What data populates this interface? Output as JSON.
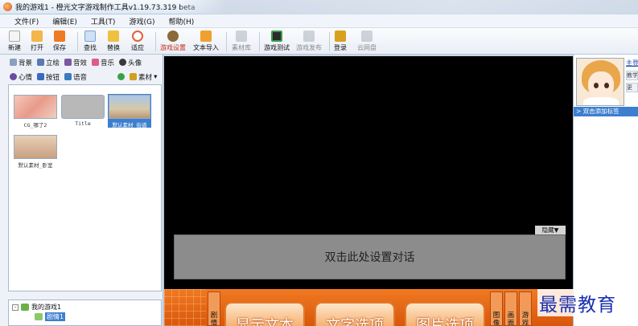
{
  "window": {
    "title": "我的游戏1 - 橙光文字游戏制作工具v1.19.73.319 beta"
  },
  "menu": [
    {
      "label": "文件(F)"
    },
    {
      "label": "编辑(E)"
    },
    {
      "label": "工具(T)"
    },
    {
      "label": "游戏(G)"
    },
    {
      "label": "帮助(H)"
    }
  ],
  "toolbar": [
    {
      "label": "新建",
      "icon": "new-file-icon",
      "color": "#f0f0f0"
    },
    {
      "label": "打开",
      "icon": "folder-open-icon",
      "color": "#f2b64a"
    },
    {
      "label": "保存",
      "icon": "save-icon",
      "color": "#f07a22"
    },
    {
      "label": "查找",
      "icon": "find-icon",
      "color": "#7ba2d6"
    },
    {
      "label": "替换",
      "icon": "replace-icon",
      "color": "#f0c040"
    },
    {
      "label": "适应",
      "icon": "fit-icon",
      "color": "#e0603a"
    },
    {
      "label": "游戏设置",
      "icon": "gear-icon",
      "color": "#8a6a3a"
    },
    {
      "label": "文本导入",
      "icon": "text-import-icon",
      "color": "#f0a030"
    },
    {
      "label": "素材库",
      "icon": "library-icon",
      "color": "#9aa4ae"
    },
    {
      "label": "游戏测试",
      "icon": "game-test-icon",
      "color": "#3aa04a"
    },
    {
      "label": "游戏发布",
      "icon": "publish-icon",
      "color": "#9aa4ae"
    },
    {
      "label": "登录",
      "icon": "login-icon",
      "color": "#d9a020"
    },
    {
      "label": "云网盘",
      "icon": "cloud-drive-icon",
      "color": "#9aa4ae"
    }
  ],
  "categories_row1": [
    {
      "label": "背景",
      "icon": "background-icon",
      "color": "#8aa0c0"
    },
    {
      "label": "立绘",
      "icon": "portrait-icon",
      "color": "#5a7ab0"
    },
    {
      "label": "音效",
      "icon": "sound-effect-icon",
      "color": "#7a5aa0"
    },
    {
      "label": "音乐",
      "icon": "music-icon",
      "color": "#e05a8a"
    },
    {
      "label": "头像",
      "icon": "avatar-icon",
      "color": "#3a3a3a"
    }
  ],
  "categories_row2": [
    {
      "label": "心情",
      "icon": "mood-icon",
      "color": "#6a4aa0"
    },
    {
      "label": "按钮",
      "icon": "button-icon",
      "color": "#3a6ac0"
    },
    {
      "label": "语音",
      "icon": "voice-icon",
      "color": "#3a7ac0"
    },
    {
      "label": "素材",
      "icon": "material-icon",
      "color": "#d0a020"
    }
  ],
  "thumbnails": [
    {
      "caption": "CG_哪了2",
      "color": "#f0b8a8"
    },
    {
      "caption": "Title",
      "color": "#b8b8b8"
    },
    {
      "caption": "默认素材_街道",
      "color": "#8ab0d8"
    },
    {
      "caption": "默认素材_卧室",
      "color": "#d8b8a0"
    }
  ],
  "tree": {
    "root": "我的游戏1",
    "child": "剧情1"
  },
  "stage": {
    "hide_label": "隐藏▼",
    "dialog_hint": "双击此处设置对话"
  },
  "bottom": {
    "vlabel_left": "剧情",
    "buttons": [
      "显示文本",
      "文字选项",
      "图片选项"
    ],
    "vlabels_right": [
      "图像",
      "画面",
      "游戏"
    ]
  },
  "right": {
    "link": "主登",
    "tags": [
      "教学",
      "更"
    ],
    "add_label": "> 双击添加标签"
  },
  "watermark": "最需教育"
}
